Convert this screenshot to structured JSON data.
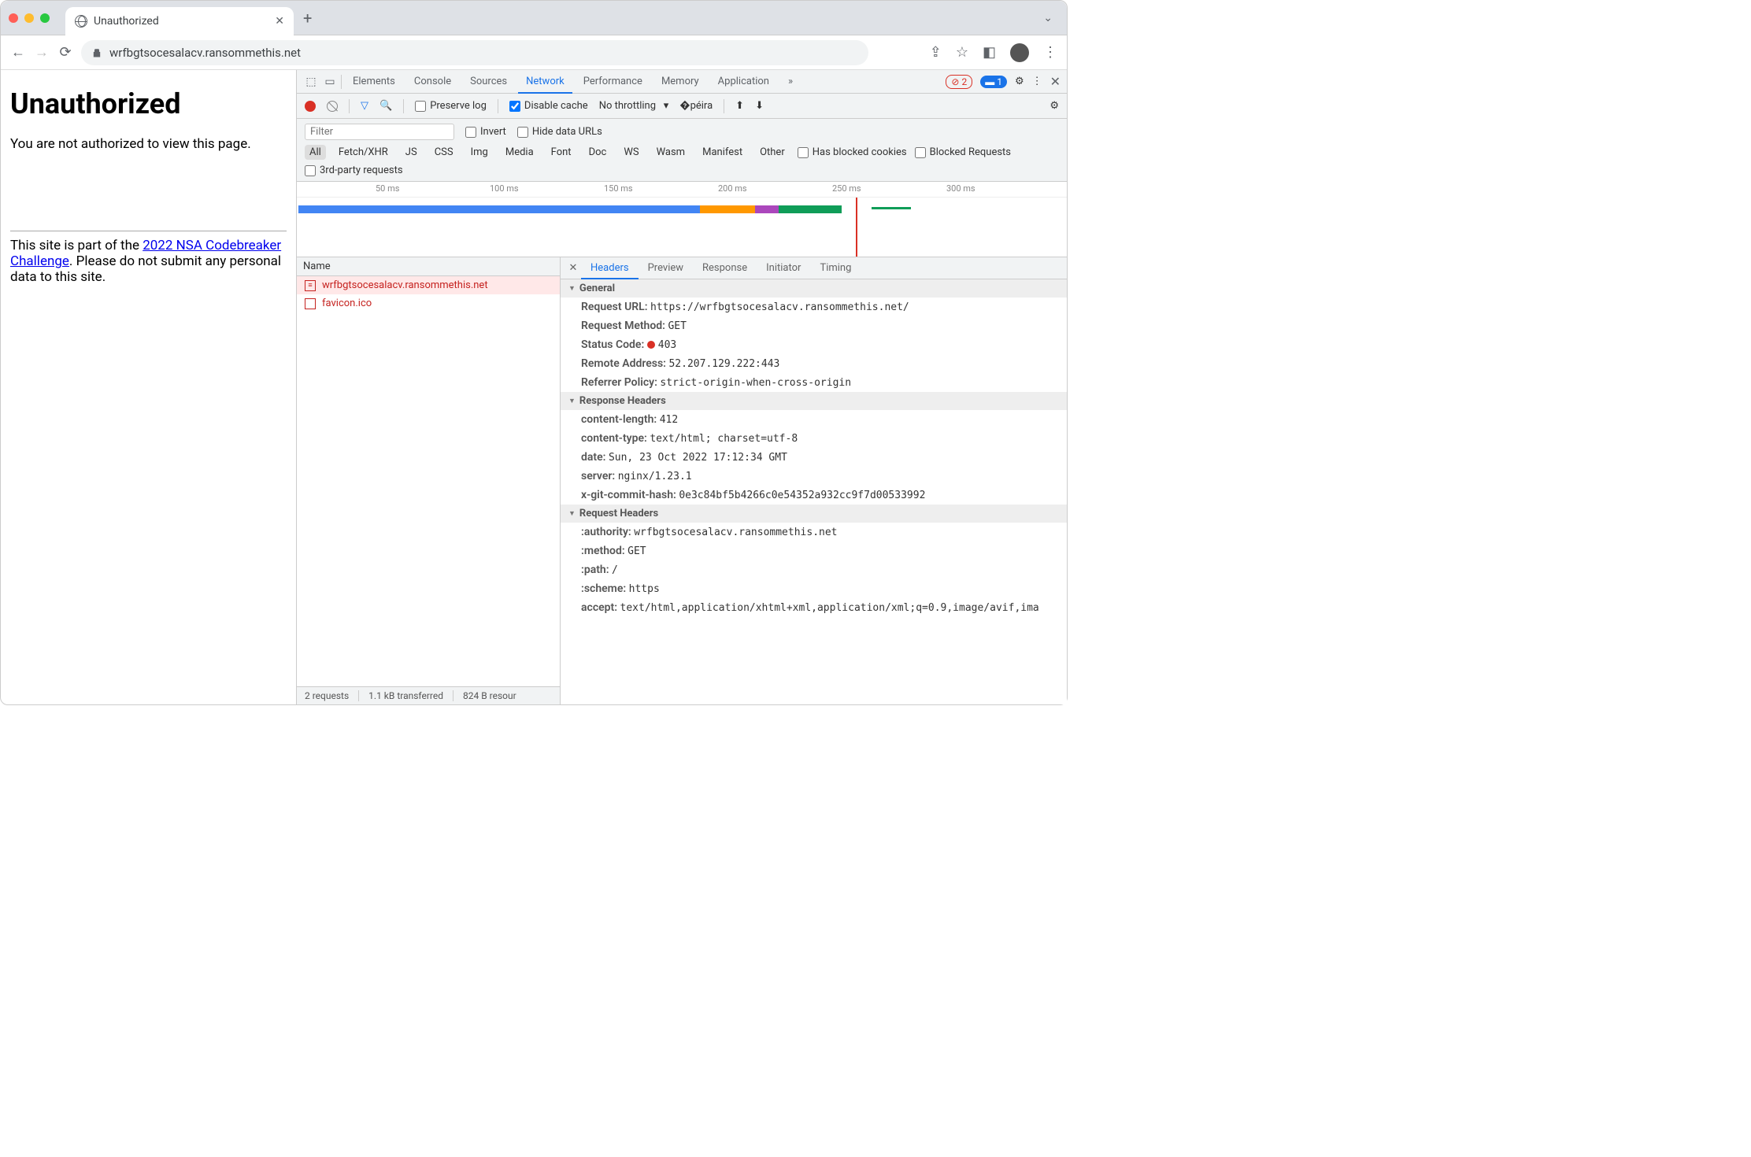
{
  "tab": {
    "title": "Unauthorized"
  },
  "url": "wrfbgtsocesalacv.ransommethis.net",
  "page": {
    "h1": "Unauthorized",
    "p": "You are not authorized to view this page.",
    "foot_pre": "This site is part of the ",
    "foot_link": "2022 NSA Codebreaker Challenge",
    "foot_post": ". Please do not submit any personal data to this site."
  },
  "devtools": {
    "tabs": [
      "Elements",
      "Console",
      "Sources",
      "Network",
      "Performance",
      "Memory",
      "Application"
    ],
    "active_tab": "Network",
    "more": "»",
    "err_count": "2",
    "msg_count": "1",
    "toolbar": {
      "preserve": "Preserve log",
      "disable": "Disable cache",
      "throttle": "No throttling"
    },
    "filter": {
      "placeholder": "Filter",
      "invert": "Invert",
      "hide": "Hide data URLs",
      "pills": [
        "All",
        "Fetch/XHR",
        "JS",
        "CSS",
        "Img",
        "Media",
        "Font",
        "Doc",
        "WS",
        "Wasm",
        "Manifest",
        "Other"
      ],
      "blocked_cookies": "Has blocked cookies",
      "blocked_req": "Blocked Requests",
      "third": "3rd-party requests"
    },
    "timeline_ticks": [
      "50 ms",
      "100 ms",
      "150 ms",
      "200 ms",
      "250 ms",
      "300 ms"
    ],
    "reqlist": {
      "hdr": "Name",
      "rows": [
        "wrfbgtsocesalacv.ransommethis.net",
        "favicon.ico"
      ]
    },
    "statusbar": [
      "2 requests",
      "1.1 kB transferred",
      "824 B resour"
    ],
    "detail_tabs": [
      "Headers",
      "Preview",
      "Response",
      "Initiator",
      "Timing"
    ],
    "general": {
      "title": "General",
      "rows": [
        {
          "k": "Request URL:",
          "v": "https://wrfbgtsocesalacv.ransommethis.net/"
        },
        {
          "k": "Request Method:",
          "v": "GET"
        },
        {
          "k": "Status Code:",
          "v": "403",
          "dot": true
        },
        {
          "k": "Remote Address:",
          "v": "52.207.129.222:443"
        },
        {
          "k": "Referrer Policy:",
          "v": "strict-origin-when-cross-origin"
        }
      ]
    },
    "response_headers": {
      "title": "Response Headers",
      "rows": [
        {
          "k": "content-length:",
          "v": "412"
        },
        {
          "k": "content-type:",
          "v": "text/html; charset=utf-8"
        },
        {
          "k": "date:",
          "v": "Sun, 23 Oct 2022 17:12:34 GMT"
        },
        {
          "k": "server:",
          "v": "nginx/1.23.1"
        },
        {
          "k": "x-git-commit-hash:",
          "v": "0e3c84bf5b4266c0e54352a932cc9f7d00533992"
        }
      ]
    },
    "request_headers": {
      "title": "Request Headers",
      "rows": [
        {
          "k": ":authority:",
          "v": "wrfbgtsocesalacv.ransommethis.net"
        },
        {
          "k": ":method:",
          "v": "GET"
        },
        {
          "k": ":path:",
          "v": "/"
        },
        {
          "k": ":scheme:",
          "v": "https"
        },
        {
          "k": "accept:",
          "v": "text/html,application/xhtml+xml,application/xml;q=0.9,image/avif,ima"
        }
      ]
    }
  }
}
